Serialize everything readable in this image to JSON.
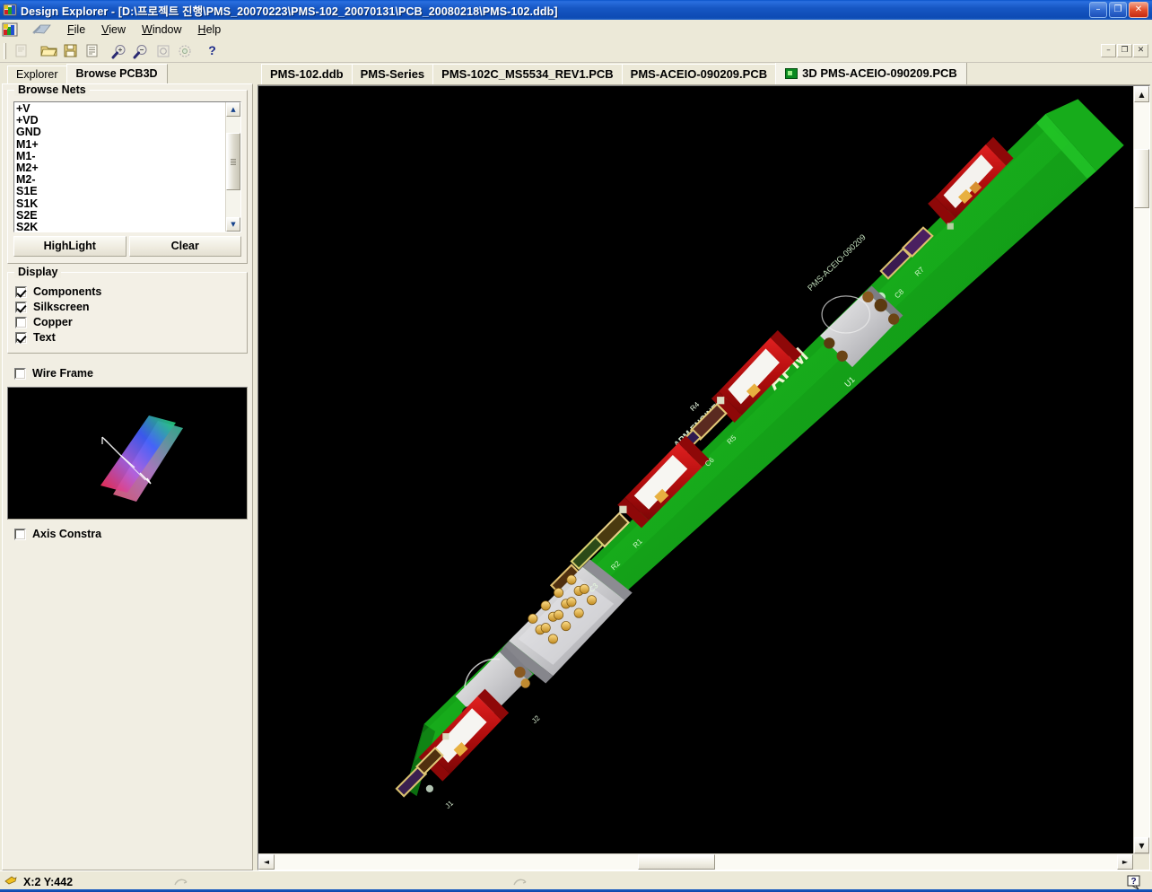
{
  "window": {
    "title": "Design Explorer - [D:\\프로젝트 진행\\PMS_20070223\\PMS-102_20070131\\PCB_20080218\\PMS-102.ddb]",
    "app_icon": "design-explorer-icon",
    "buttons": {
      "minimize": "–",
      "maximize": "❐",
      "close": "✕"
    }
  },
  "menu": {
    "items": [
      {
        "label": "File",
        "accel": "F"
      },
      {
        "label": "View",
        "accel": "V"
      },
      {
        "label": "Window",
        "accel": "W"
      },
      {
        "label": "Help",
        "accel": "H"
      }
    ]
  },
  "toolbar": {
    "buttons": [
      {
        "name": "new-document-icon",
        "glyph": "▤",
        "enabled": false
      },
      {
        "name": "open-folder-icon",
        "glyph": "🗁",
        "enabled": true
      },
      {
        "name": "save-icon",
        "glyph": "💾",
        "enabled": true
      },
      {
        "name": "print-preview-icon",
        "glyph": "☰",
        "enabled": true
      },
      {
        "name": "zoom-in-icon",
        "glyph": "⊕",
        "enabled": true
      },
      {
        "name": "zoom-out-icon",
        "glyph": "⊖",
        "enabled": true
      },
      {
        "name": "zoom-window-icon",
        "glyph": "▣",
        "enabled": false
      },
      {
        "name": "zoom-all-icon",
        "glyph": "◌",
        "enabled": false
      },
      {
        "name": "help-icon",
        "glyph": "?",
        "enabled": true
      }
    ],
    "mdi_buttons": {
      "minimize": "–",
      "restore": "❐",
      "close": "✕"
    }
  },
  "left_panel": {
    "tabs": [
      {
        "label": "Explorer",
        "active": false
      },
      {
        "label": "Browse PCB3D",
        "active": true
      }
    ],
    "browse_nets": {
      "title": "Browse Nets",
      "nets": [
        "+V",
        "+VD",
        "GND",
        "M1+",
        "M1-",
        "M2+",
        "M2-",
        "S1E",
        "S1K",
        "S2E",
        "S2K"
      ],
      "buttons": {
        "highlight": "HighLight",
        "clear": "Clear"
      },
      "scroll": {
        "up": "▲",
        "down": "▼"
      }
    },
    "display": {
      "title": "Display",
      "options": [
        {
          "label": "Components",
          "checked": true
        },
        {
          "label": "Silkscreen",
          "checked": true
        },
        {
          "label": "Copper",
          "checked": false
        },
        {
          "label": "Text",
          "checked": true
        }
      ]
    },
    "wire_frame": {
      "label": "Wire Frame",
      "checked": false
    },
    "axis_constrain": {
      "label": "Axis Constra",
      "checked": false
    },
    "preview": {
      "name": "orientation-gizmo-preview"
    }
  },
  "document_tabs": [
    {
      "label": "PMS-102.ddb",
      "active": false,
      "icon": null
    },
    {
      "label": "PMS-Series",
      "active": false,
      "icon": null
    },
    {
      "label": "PMS-102C_MS5534_REV1.PCB",
      "active": false,
      "icon": null
    },
    {
      "label": "PMS-ACEIO-090209.PCB",
      "active": false,
      "icon": null
    },
    {
      "label": "3D PMS-ACEIO-090209.PCB",
      "active": true,
      "icon": "pcb3d-icon"
    }
  ],
  "viewport": {
    "name": "pcb-3d-viewport",
    "background": "#000000",
    "board_color": "#16a81a",
    "silkscreen_texts": [
      "APM",
      "APM ENGINEERING CO.,LTD",
      "PMS-ACEIO-090209"
    ],
    "scrollbars": {
      "vertical": {
        "up": "▲",
        "down": "▼"
      },
      "horizontal": {
        "left": "◄",
        "right": "►"
      }
    }
  },
  "statusbar": {
    "pointer_icon": "hand-pointer-icon",
    "coordinates": "X:2 Y:442",
    "indicators": [
      "arrow-indicator-1",
      "arrow-indicator-2"
    ],
    "help_icon": "question-balloon-icon"
  },
  "colors": {
    "titlebar_blue": "#0a53c8",
    "board_green": "#16a81a",
    "connector_red": "#c21010",
    "face_beige": "#ece9d8"
  }
}
